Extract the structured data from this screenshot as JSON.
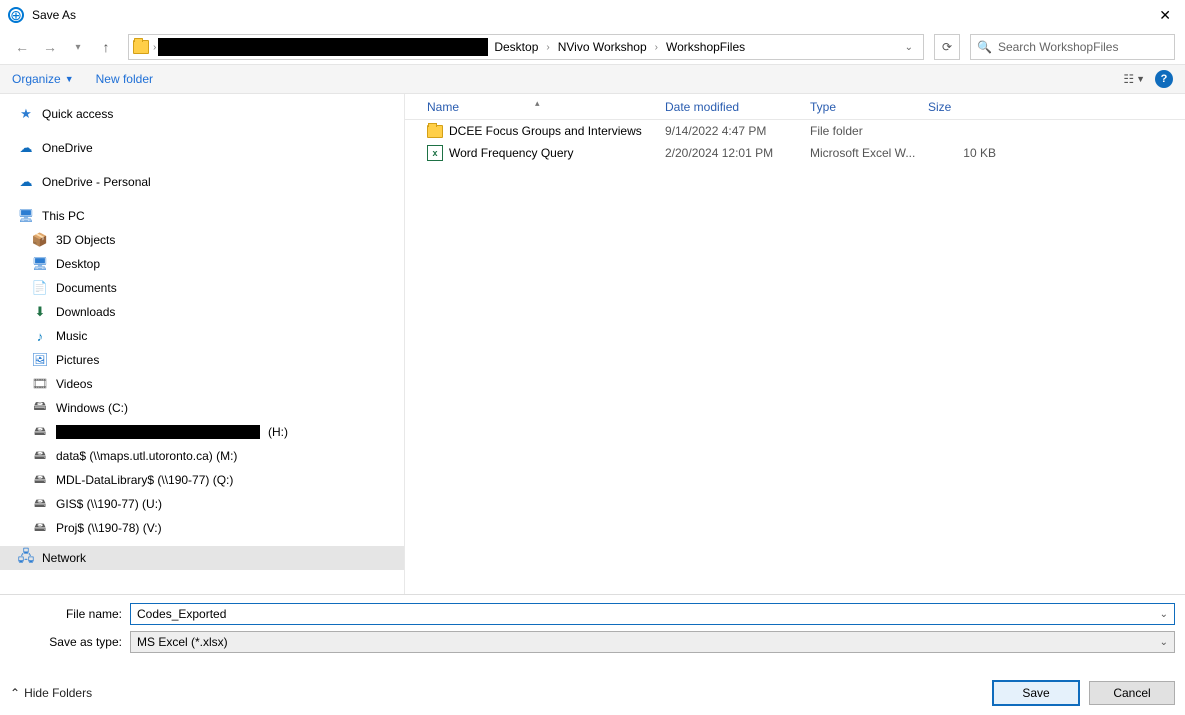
{
  "title": "Save As",
  "breadcrumbs": [
    "Desktop",
    "NVivo Workshop",
    "WorkshopFiles"
  ],
  "search_placeholder": "Search WorkshopFiles",
  "toolbar": {
    "organize": "Organize",
    "new_folder": "New folder"
  },
  "help_label": "?",
  "tree": {
    "quick_access": "Quick access",
    "onedrive": "OneDrive",
    "onedrive_personal": "OneDrive - Personal",
    "this_pc": "This PC",
    "objects3d": "3D Objects",
    "desktop": "Desktop",
    "documents": "Documents",
    "downloads": "Downloads",
    "music": "Music",
    "pictures": "Pictures",
    "videos": "Videos",
    "windows_c": "Windows (C:)",
    "home_h_suffix": "(H:)",
    "data": "data$ (\\\\maps.utl.utoronto.ca) (M:)",
    "mdl": "MDL-DataLibrary$ (\\\\190-77) (Q:)",
    "gis": "GIS$ (\\\\190-77) (U:)",
    "proj": "Proj$ (\\\\190-78) (V:)",
    "network": "Network"
  },
  "columns": {
    "name": "Name",
    "date": "Date modified",
    "type": "Type",
    "size": "Size"
  },
  "files": [
    {
      "name": "DCEE Focus Groups and Interviews",
      "date": "9/14/2022 4:47 PM",
      "type": "File folder",
      "size": "",
      "kind": "folder"
    },
    {
      "name": "Word Frequency Query",
      "date": "2/20/2024 12:01 PM",
      "type": "Microsoft Excel W...",
      "size": "10 KB",
      "kind": "excel"
    }
  ],
  "labels": {
    "file_name": "File name:",
    "save_as_type": "Save as type:",
    "hide_folders": "Hide Folders"
  },
  "file_name_value": "Codes_Exported",
  "save_as_type_value": "MS Excel (*.xlsx)",
  "buttons": {
    "save": "Save",
    "cancel": "Cancel"
  }
}
